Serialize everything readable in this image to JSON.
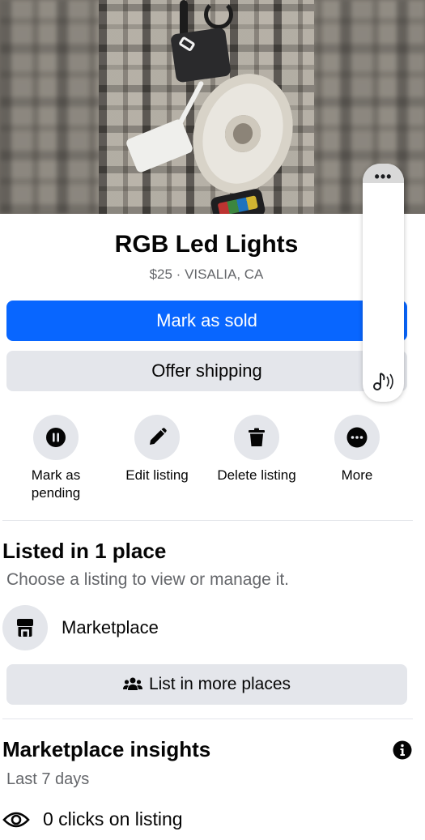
{
  "listing": {
    "title": "RGB Led Lights",
    "subtitle": "$25 · VISALIA, CA"
  },
  "buttons": {
    "mark_sold": "Mark as sold",
    "offer_shipping": "Offer shipping",
    "list_more": "List in more places"
  },
  "actions": [
    {
      "label": "Mark as pending",
      "icon": "pause-icon"
    },
    {
      "label": "Edit listing",
      "icon": "pencil-icon"
    },
    {
      "label": "Delete listing",
      "icon": "trash-icon"
    },
    {
      "label": "More",
      "icon": "more-icon"
    }
  ],
  "listed": {
    "title": "Listed in 1 place",
    "subtitle": "Choose a listing to view or manage it.",
    "place": "Marketplace"
  },
  "insights": {
    "title": "Marketplace insights",
    "period": "Last 7 days",
    "clicks": "0 clicks on listing"
  },
  "colors": {
    "primary": "#0866ff",
    "secondary_bg": "#e4e6eb",
    "muted_text": "#65676b"
  }
}
